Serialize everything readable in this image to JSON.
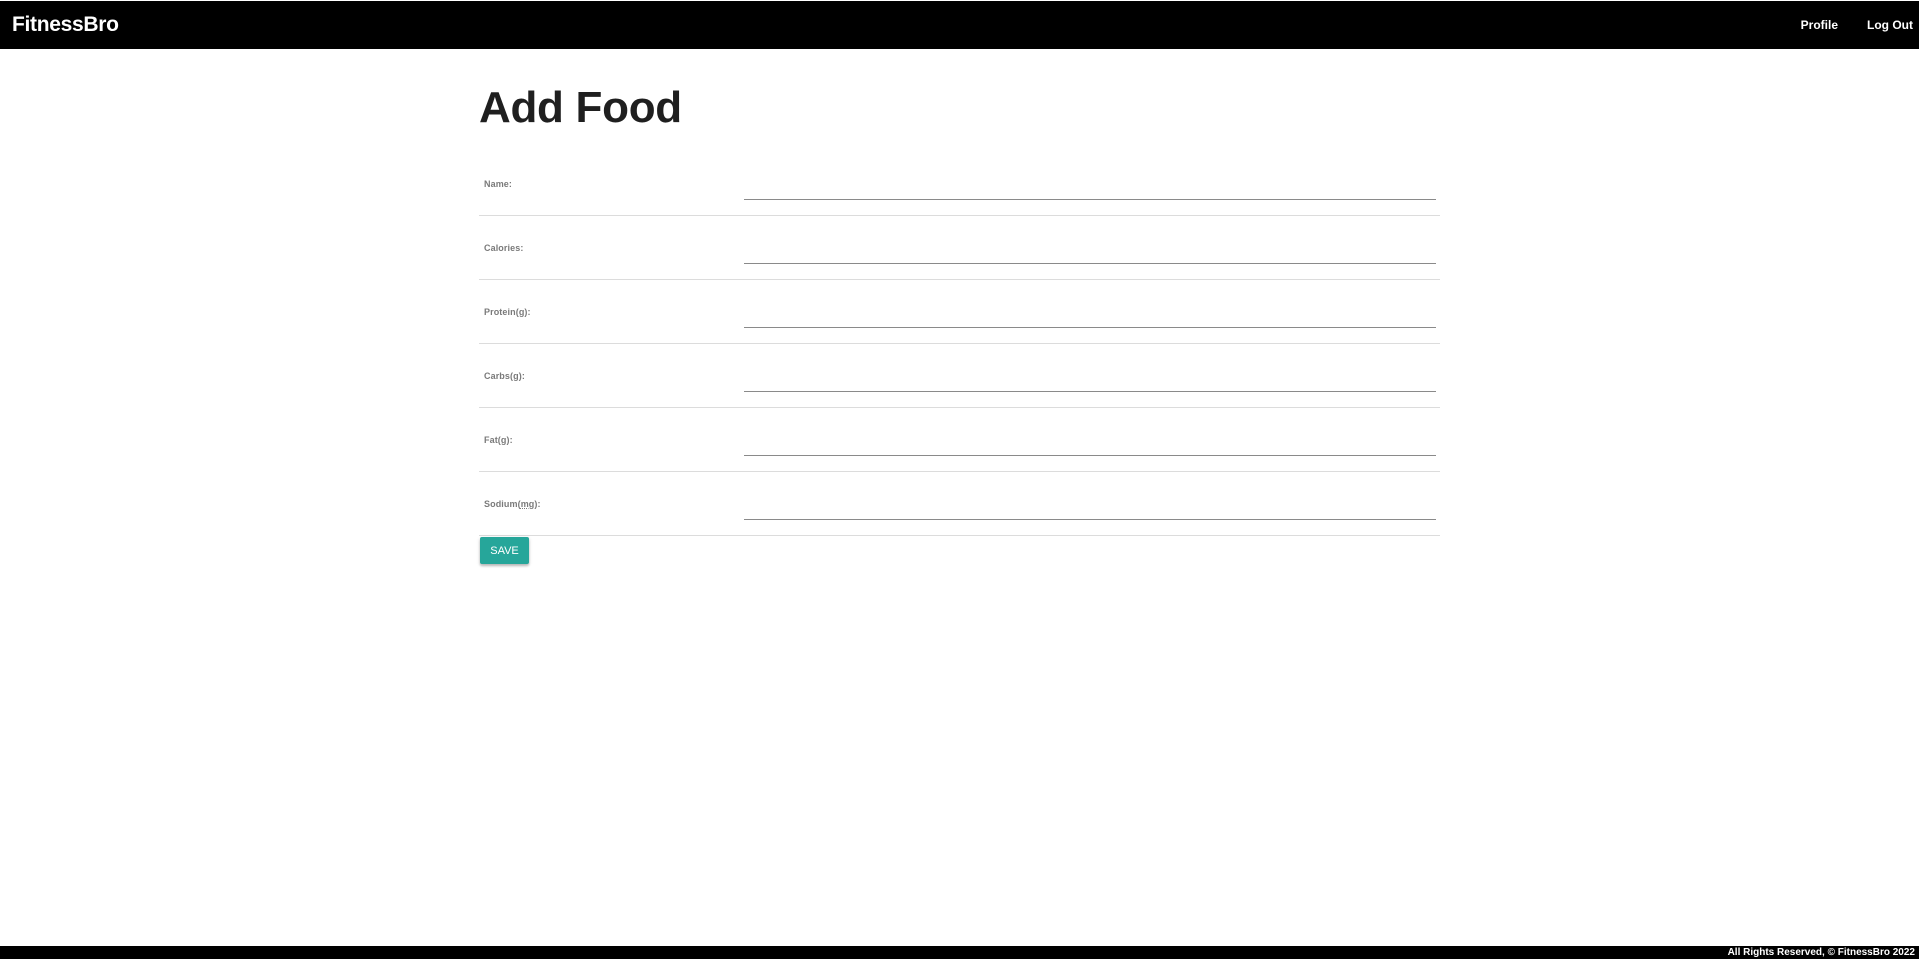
{
  "colors": {
    "navbar_bg": "#000000",
    "button_bg": "#26a69a",
    "label_text": "#7a7a7a"
  },
  "navbar": {
    "brand": "FitnessBro",
    "links": [
      {
        "label": "Profile"
      },
      {
        "label": "Log Out"
      }
    ]
  },
  "page": {
    "title": "Add Food"
  },
  "form": {
    "fields": [
      {
        "label": "Name:",
        "value": ""
      },
      {
        "label_prefix": "Calories:",
        "value": ""
      },
      {
        "label_prefix": "Protein(",
        "unit": "g",
        "label_suffix": "):",
        "value": ""
      },
      {
        "label_prefix": "Carbs(",
        "unit": "g",
        "label_suffix": "):",
        "value": ""
      },
      {
        "label_prefix": "Fat(",
        "unit": "g",
        "label_suffix": "):",
        "value": ""
      },
      {
        "label_prefix": "Sodium(",
        "unit": "mg",
        "label_suffix": "):",
        "value": ""
      }
    ],
    "save_label": "Save"
  },
  "footer": {
    "text": "All Rights Reserved, © FitnessBro 2022"
  }
}
